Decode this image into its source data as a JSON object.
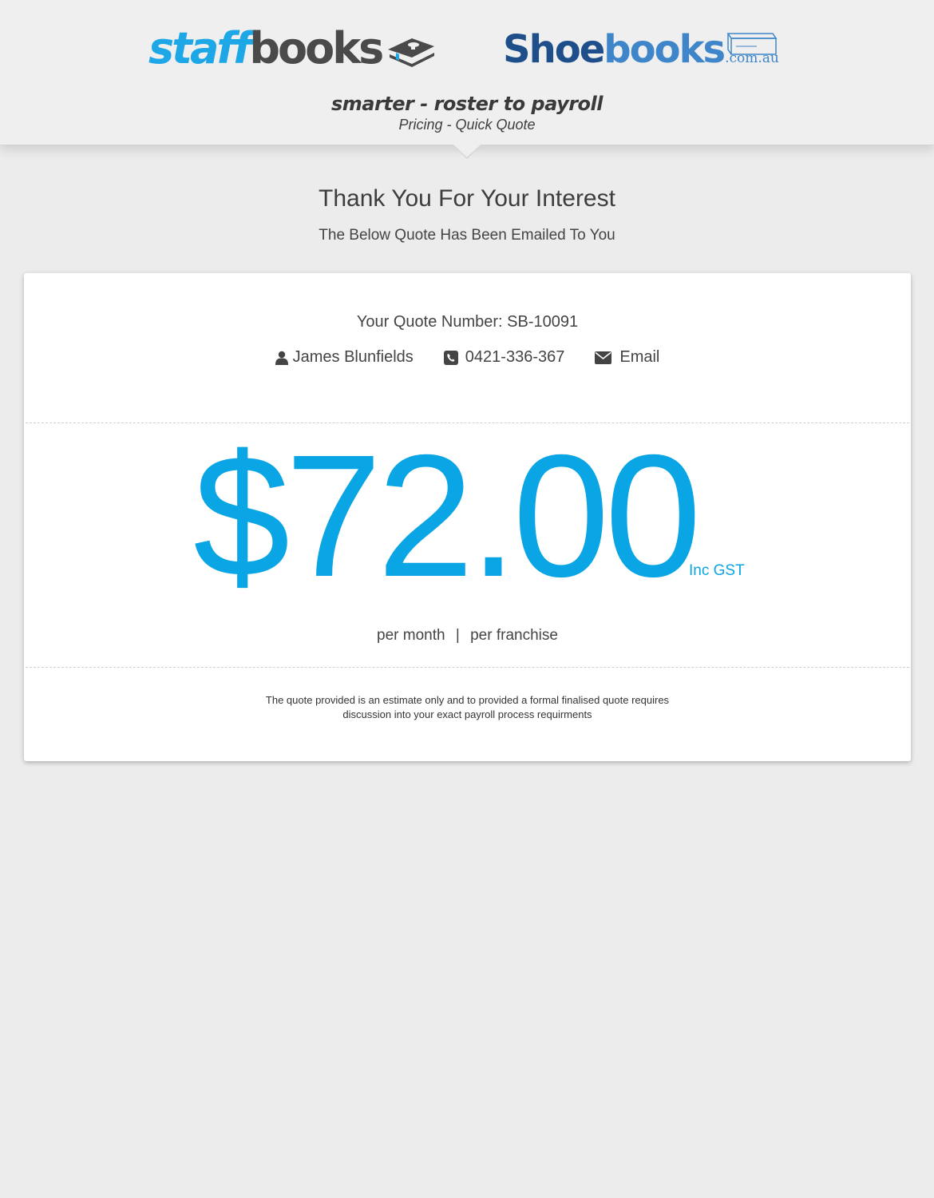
{
  "header": {
    "logo_staff_part1": "staff",
    "logo_staff_part2": "books",
    "logo_shoe_part1": "Shoe",
    "logo_shoe_part2": "books",
    "logo_shoe_suffix": ".com.au",
    "tagline": "smarter - roster to payroll",
    "subtitle": "Pricing - Quick Quote"
  },
  "intro": {
    "heading": "Thank You For Your Interest",
    "subheading": "The Below Quote Has Been Emailed To You"
  },
  "quote": {
    "number_label": "Your Quote Number: SB-10091",
    "contact": {
      "name": "James Blunfields",
      "phone": "0421-336-367",
      "email_label": "Email"
    },
    "price": "$72.00",
    "gst_label": "Inc GST",
    "per_month": "per month",
    "separator": "|",
    "per_franchise": "per franchise",
    "disclaimer_line1": "The quote provided is an estimate only and to provided a formal finalised quote requires",
    "disclaimer_line2": "discussion into your exact payroll process requirments"
  },
  "colors": {
    "accent": "#0aa5e4",
    "staff_blue": "#1ea7e6",
    "shoe_dark_blue": "#1f4f8b",
    "shoe_light_blue": "#3e86c9",
    "text": "#444444"
  },
  "icons": {
    "logo_icon": "graduation-cap-book-icon",
    "shoebox_icon": "shoebox-icon",
    "user_icon": "user-icon",
    "phone_icon": "phone-square-icon",
    "email_icon": "envelope-icon"
  }
}
